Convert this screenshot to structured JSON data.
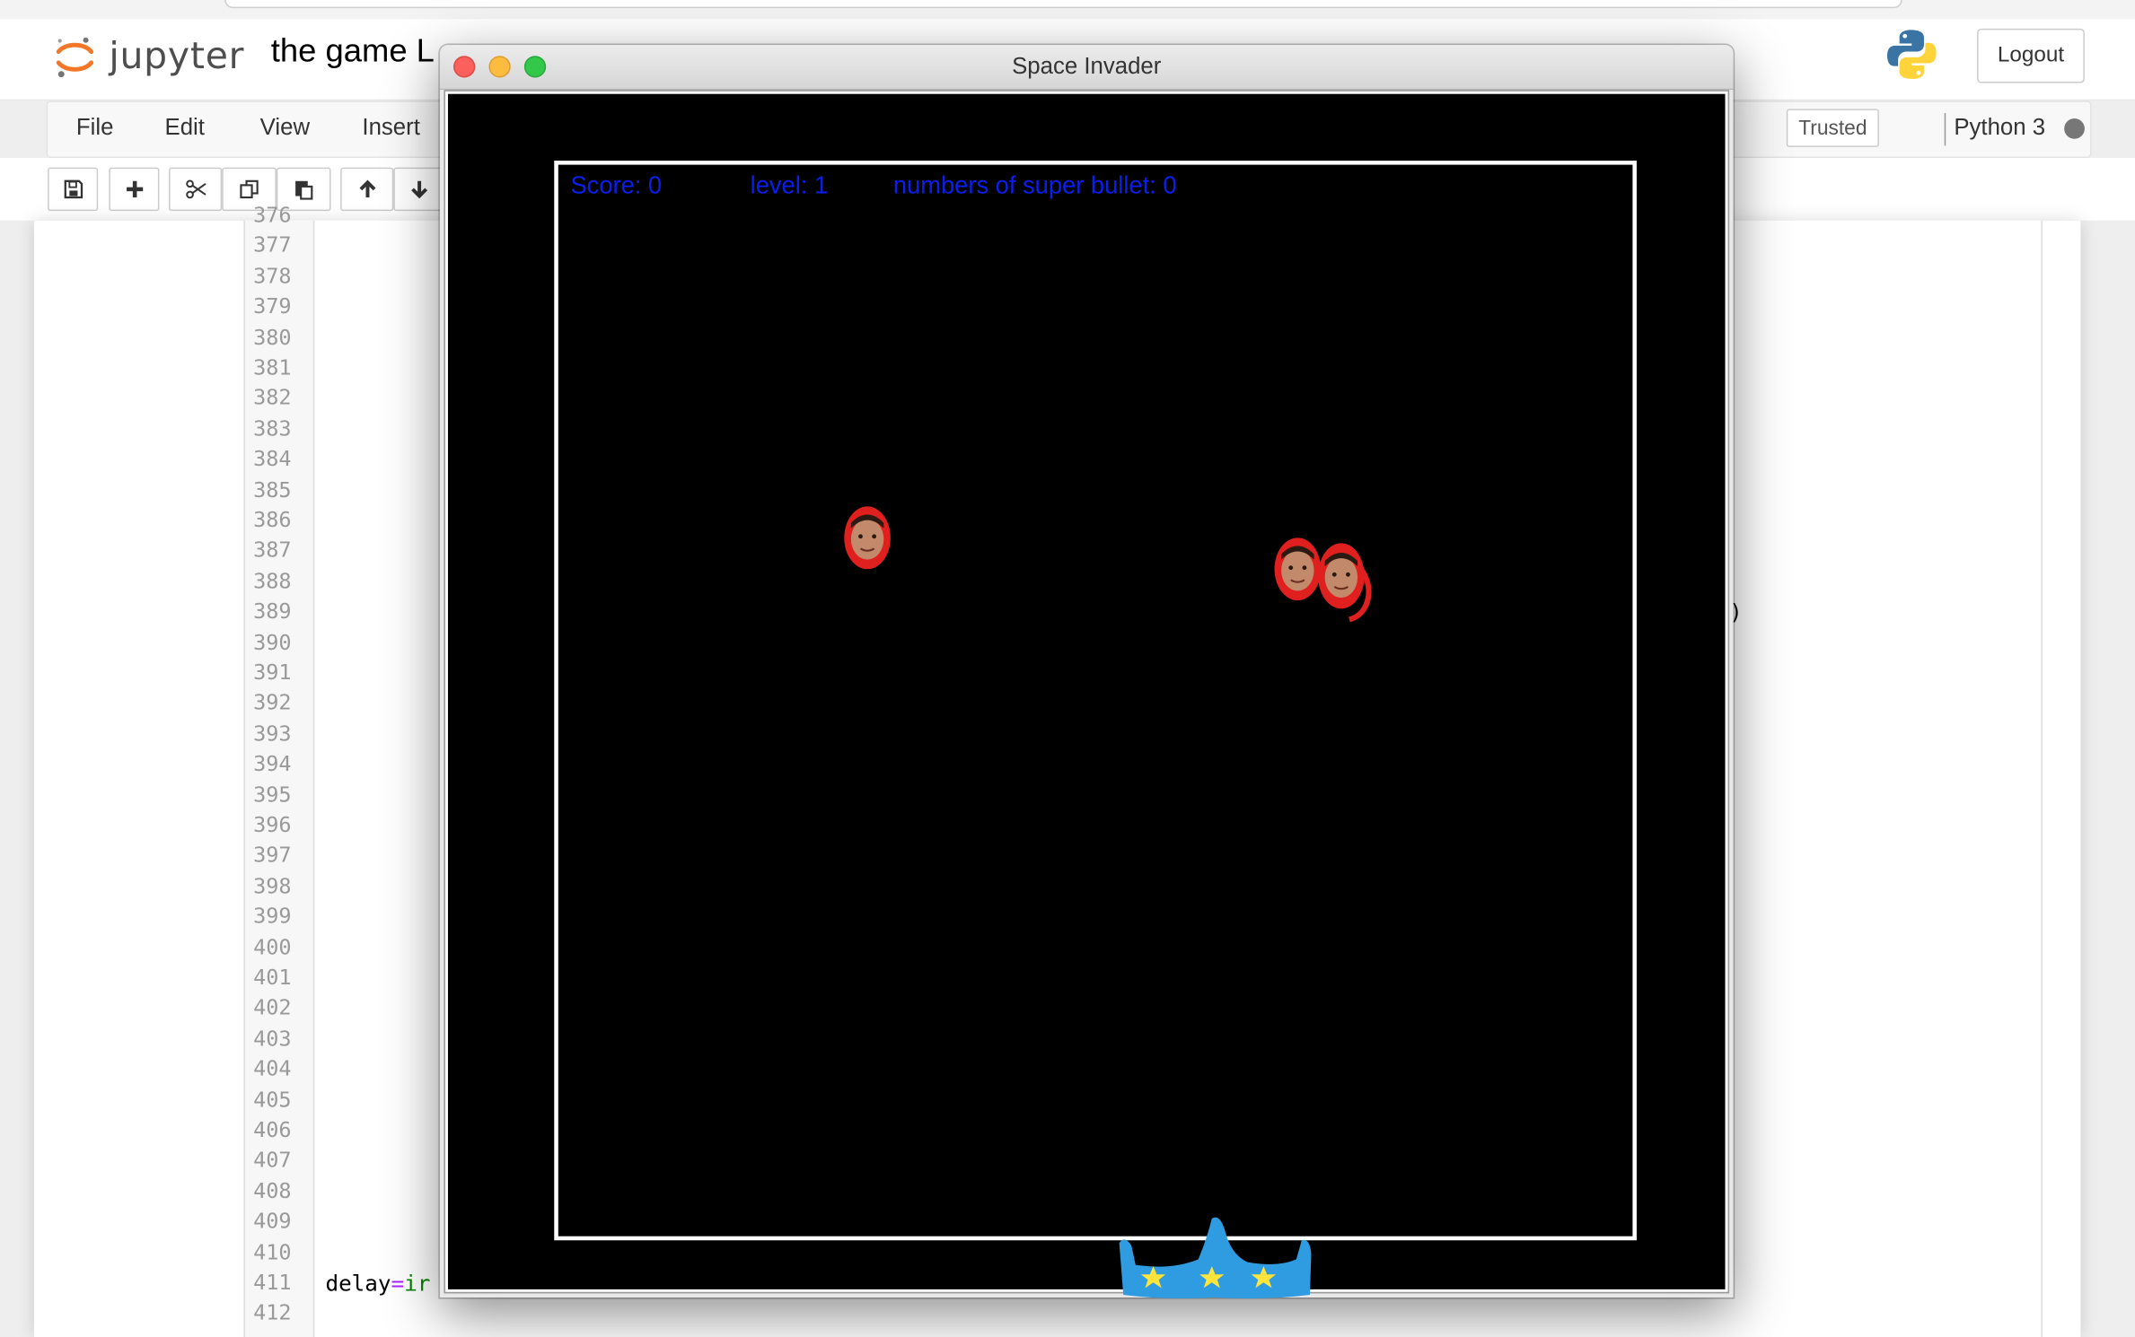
{
  "header": {
    "logo_text": "jupyter",
    "notebook_title": "the game L",
    "logout_label": "Logout"
  },
  "menubar": {
    "items": [
      "File",
      "Edit",
      "View",
      "Insert"
    ],
    "trusted_label": "Trusted",
    "kernel_name": "Python 3"
  },
  "toolbar": {
    "buttons": [
      "save-icon",
      "plus-icon",
      "cut-icon",
      "copy-icon",
      "paste-icon",
      "arrow-up-icon",
      "arrow-down-icon"
    ]
  },
  "code": {
    "line_numbers": [
      "376",
      "377",
      "378",
      "379",
      "380",
      "381",
      "382",
      "383",
      "384",
      "385",
      "386",
      "387",
      "388",
      "389",
      "390",
      "391",
      "392",
      "393",
      "394",
      "395",
      "396",
      "397",
      "398",
      "399",
      "400",
      "401",
      "402",
      "403",
      "404",
      "405",
      "406",
      "407",
      "408",
      "409",
      "410",
      "411",
      "412"
    ],
    "line_411_text": "delay",
    "line_411_op": "=",
    "line_411_fn": "ir",
    "fragment_389": ")"
  },
  "game_window": {
    "title": "Space Invader",
    "hud": {
      "score": "Score: 0",
      "level": "level: 1",
      "super_bullets": "numbers of super bullet: 0"
    },
    "hud_color": "#0a1ef0",
    "invaders": [
      "invader-face-icon",
      "invader-face-icon",
      "invader-face-icon"
    ],
    "player": "player-ship-icon"
  },
  "colors": {
    "jupyter_orange": "#f37726",
    "ship_blue": "#2f9be0",
    "star_yellow": "#ffe53b",
    "invader_red": "#e0201e"
  }
}
